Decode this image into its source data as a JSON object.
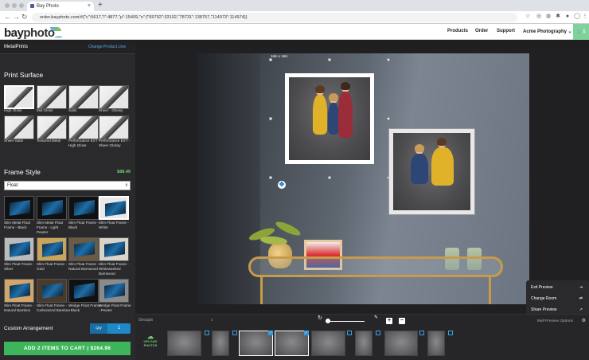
{
  "browser": {
    "tab_title": "Bay Photo",
    "tab_close": "×",
    "new_tab": "+",
    "url": "order.bayphoto.com/#{\"c\":5617,\"l\":4877,\"p\":15409,\"o\":{\"65792\":33102,\"78731\":138757,\"114973\":114974}}",
    "back": "←",
    "forward": "→",
    "reload": "↻"
  },
  "header": {
    "logo_bay": "bay",
    "logo_photo": "photo",
    "logo_com": ".com",
    "nav": [
      "Products",
      "Order",
      "Support",
      "Acme Photography ⌄"
    ],
    "cart_count": "1"
  },
  "sidebar": {
    "product_line": "MetalPrints",
    "change_link": "Change Product Line",
    "print_surface_title": "Print Surface",
    "surfaces": [
      "High Gloss",
      "Mid Gloss",
      "Satin",
      "Sheer - Glossy",
      "Sheer-Satin",
      "Textured Metal",
      "Performance EXT - High Gloss",
      "Performance EXT - Sheer Glossy"
    ],
    "frame_style_title": "Frame Style",
    "frame_price": "$88.49",
    "frame_select_value": "Float",
    "frames": [
      "Slim Metal Float Frame - Black",
      "Slim Metal Float Frame - Light Pewter",
      "Slim Float Frame - Black",
      "Slim Float Frame - White",
      "Slim Float Frame - Silver",
      "Slim Float Frame - Gold",
      "Slim Float Frame - Natural Barnwood",
      "Slim Float Frame - Whitewashed Barnwood",
      "Slim Float Frame - Natural Bamboo",
      "Slim Float Frame - Carbonized Bamboo",
      "Wedge Float Frame - Black",
      "Wedge Float Frame - Pewter"
    ],
    "custom_arrangement": "Custom Arrangement",
    "qty_label": "Qty",
    "qty_value": "1",
    "add_to_cart": "ADD 2 ITEMS TO CART | $264.96"
  },
  "canvas": {
    "size_label": "16in x 16in",
    "menu": [
      {
        "label": "Exit Preview",
        "icon": "exit-icon"
      },
      {
        "label": "Change Room",
        "icon": "swap-icon"
      },
      {
        "label": "Share Preview",
        "icon": "share-icon"
      }
    ]
  },
  "bottom": {
    "groups_label": "Groups",
    "upload_label": "UPLOAD PHOTOS",
    "wall_preview_options": "Wall Preview Options",
    "thumb_checks": [
      false,
      false,
      true,
      true,
      false,
      false,
      false,
      false
    ]
  },
  "colors": {
    "accent_green": "#3fb55b",
    "accent_blue": "#1e88c8",
    "link_blue": "#5aa9e6"
  }
}
